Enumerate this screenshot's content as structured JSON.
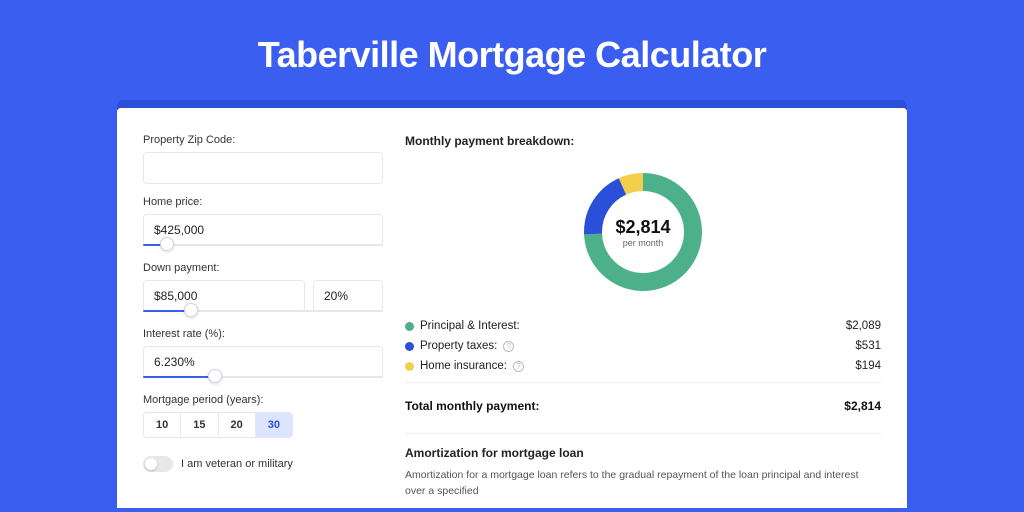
{
  "hero": {
    "title": "Taberville Mortgage Calculator"
  },
  "form": {
    "zip_label": "Property Zip Code:",
    "zip_value": "",
    "home_price_label": "Home price:",
    "home_price_value": "$425,000",
    "home_price_slider_pct": 10,
    "down_label": "Down payment:",
    "down_value": "$85,000",
    "down_pct_value": "20%",
    "down_slider_pct": 20,
    "rate_label": "Interest rate (%):",
    "rate_value": "6.230%",
    "rate_slider_pct": 30,
    "period_label": "Mortgage period (years):",
    "periods": [
      "10",
      "15",
      "20",
      "30"
    ],
    "period_active": "30",
    "veteran_label": "I am veteran or military"
  },
  "breakdown": {
    "title": "Monthly payment breakdown:",
    "center_amount": "$2,814",
    "center_sub": "per month",
    "items": [
      {
        "label": "Principal & Interest:",
        "value": "$2,089",
        "color": "#4cb08a",
        "help": false
      },
      {
        "label": "Property taxes:",
        "value": "$531",
        "color": "#2a4fd8",
        "help": true
      },
      {
        "label": "Home insurance:",
        "value": "$194",
        "color": "#f2cf4a",
        "help": true
      }
    ],
    "total_label": "Total monthly payment:",
    "total_value": "$2,814"
  },
  "chart_data": {
    "type": "pie",
    "title": "Monthly payment breakdown",
    "series": [
      {
        "name": "Principal & Interest",
        "value": 2089,
        "color": "#4cb08a"
      },
      {
        "name": "Property taxes",
        "value": 531,
        "color": "#2a4fd8"
      },
      {
        "name": "Home insurance",
        "value": 194,
        "color": "#f2cf4a"
      }
    ],
    "total": 2814,
    "center_label": "$2,814 per month"
  },
  "amort": {
    "title": "Amortization for mortgage loan",
    "body": "Amortization for a mortgage loan refers to the gradual repayment of the loan principal and interest over a specified"
  }
}
